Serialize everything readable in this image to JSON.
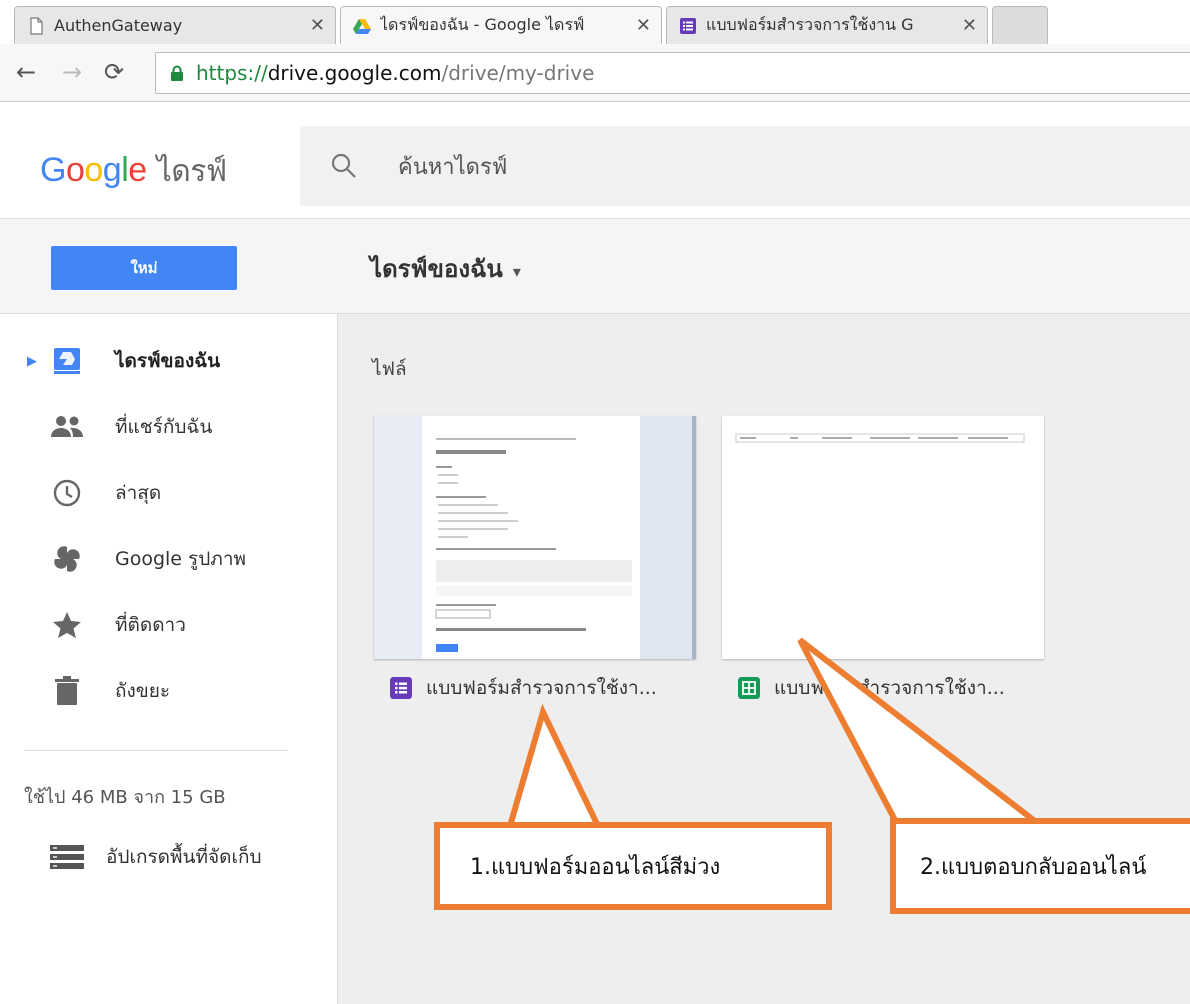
{
  "browser": {
    "tabs": [
      {
        "title": "AuthenGateway",
        "active": false,
        "icon": "page-icon"
      },
      {
        "title": "ไดรฟ์ของฉัน - Google ไดรฟ์",
        "active": true,
        "icon": "drive-icon"
      },
      {
        "title": "แบบฟอร์มสำรวจการใช้งาน G",
        "active": false,
        "icon": "forms-icon"
      }
    ],
    "close_glyph": "✕",
    "url_scheme": "https://",
    "url_host": "drive.google.com",
    "url_path": "/drive/my-drive"
  },
  "header": {
    "logo_letters": [
      "G",
      "o",
      "o",
      "g",
      "l",
      "e"
    ],
    "product": "ไดรฟ์",
    "search_placeholder": "ค้นหาไดรฟ์"
  },
  "toolbar": {
    "new_label": "ใหม่",
    "breadcrumb": "ไดรฟ์ของฉัน",
    "breadcrumb_caret": "▾"
  },
  "sidebar": {
    "items": [
      {
        "label": "ไดรฟ์ของฉัน",
        "icon": "my-drive-icon",
        "selected": true
      },
      {
        "label": "ที่แชร์กับฉัน",
        "icon": "shared-people-icon",
        "selected": false
      },
      {
        "label": "ล่าสุด",
        "icon": "clock-icon",
        "selected": false
      },
      {
        "label": "Google รูปภาพ",
        "icon": "photos-pinwheel-icon",
        "selected": false
      },
      {
        "label": "ที่ติดดาว",
        "icon": "star-icon",
        "selected": false
      },
      {
        "label": "ถังขยะ",
        "icon": "trash-icon",
        "selected": false
      }
    ],
    "storage": "ใช้ไป 46 MB จาก 15 GB",
    "upgrade_label": "อัปเกรดพื้นที่จัดเก็บ"
  },
  "main": {
    "section_title": "ไฟล์",
    "files": [
      {
        "name": "แบบฟอร์มสำรวจการใช้งา...",
        "type": "forms",
        "color": "#673ab7"
      },
      {
        "name": "แบบฟอร์มสำรวจการใช้งา...",
        "type": "sheets",
        "color": "#0f9d58"
      }
    ]
  },
  "annotations": {
    "callout_1": "1.แบบฟอร์มออนไลน์สีม่วง",
    "callout_2": "2.แบบตอบกลับออนไลน์",
    "accent_color": "#ed7d31"
  }
}
